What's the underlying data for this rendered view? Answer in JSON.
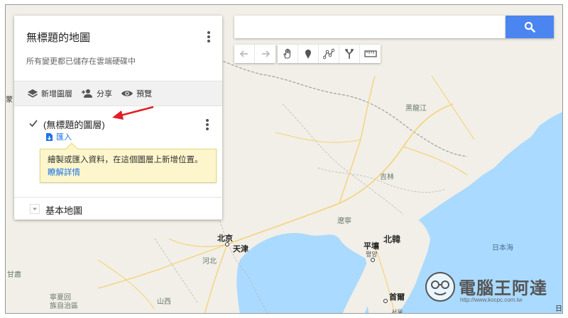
{
  "panel": {
    "map_title": "無標題的地圖",
    "save_status": "所有變更都已儲存在雲端硬碟中",
    "toolbar": {
      "add_layer": "新增圖層",
      "share": "分享",
      "preview": "預覽"
    },
    "layer": {
      "name": "(無標題的圖層)",
      "checked": true,
      "import_label": "匯入"
    },
    "tip": {
      "text": "繪製或匯入資料，在這個圖層上新增位置。",
      "link": "瞭解詳情"
    },
    "basemap_label": "基本地圖"
  },
  "search": {
    "placeholder": "",
    "value": ""
  },
  "tools": [
    "undo-icon",
    "redo-icon",
    "hand-icon",
    "marker-icon",
    "line-icon",
    "route-icon",
    "ruler-icon"
  ],
  "map": {
    "labels": {
      "heilongjiang": "黑龍江",
      "jilin": "吉林",
      "liaoning": "遼寧",
      "beijing": "北京",
      "tianjin": "天津",
      "hebei": "河北",
      "north_korea": "北韓",
      "pyongyang": "平壤",
      "pyongyang_kr": "평양",
      "sea_of_japan": "日本海",
      "gansu": "甘肅",
      "ningxia_1": "寧夏回",
      "ningxia_2": "族自治區",
      "shanxi": "山西",
      "seoul": "首爾",
      "seoul_kr": "서울",
      "edge_mong": "蒙",
      "edge_ri": "日"
    },
    "colors": {
      "land": "#f1efe7",
      "water": "#aadaff",
      "roads": "#f6d27a",
      "border": "#9e9e9e"
    }
  },
  "watermark": {
    "text": "電腦王阿達",
    "url": "http://www.kocpc.com.tw"
  }
}
